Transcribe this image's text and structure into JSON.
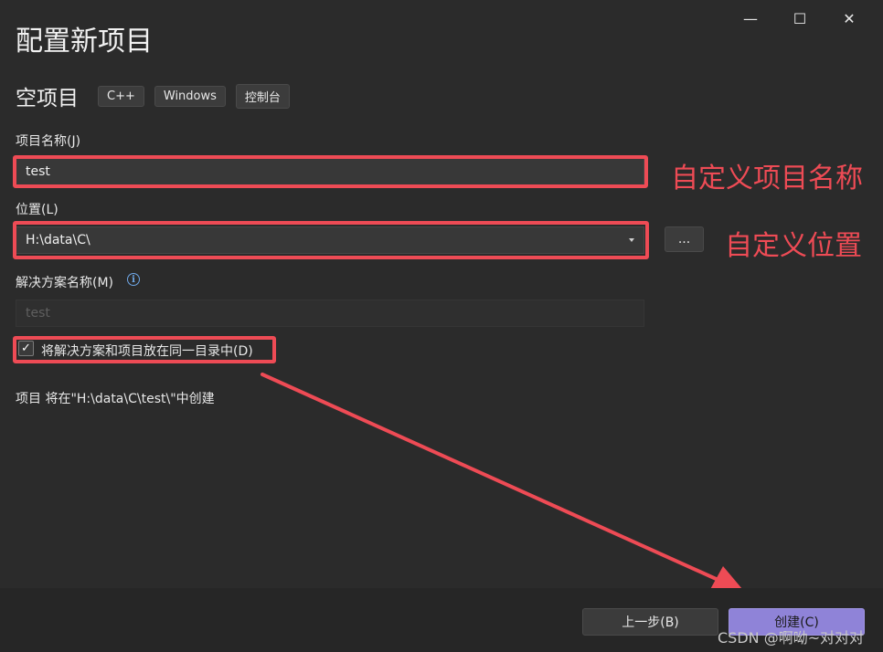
{
  "window": {
    "title": "配置新项目",
    "controls": {
      "minimize": "—",
      "maximize": "☐",
      "close": "✕"
    }
  },
  "template": {
    "name": "空项目",
    "tags": [
      "C++",
      "Windows",
      "控制台"
    ]
  },
  "fields": {
    "project_name": {
      "label": "项目名称(J)",
      "value": "test"
    },
    "location": {
      "label": "位置(L)",
      "value": "H:\\data\\C\\",
      "browse_label": "..."
    },
    "solution_name": {
      "label": "解决方案名称(M)",
      "value": "test",
      "info_icon": "i"
    }
  },
  "same_dir_checkbox": {
    "checked": true,
    "check_glyph": "✓",
    "label": "将解决方案和项目放在同一目录中(D)"
  },
  "summary": "项目 将在\"H:\\data\\C\\test\\\"中创建",
  "footer": {
    "back_label": "上一步(B)",
    "create_label": "创建(C)"
  },
  "annotations": {
    "name_note": "自定义项目名称",
    "location_note": "自定义位置"
  },
  "watermark": "CSDN @啊呦~对对对",
  "colors": {
    "background": "#2b2b2b",
    "highlight": "#ee4b55",
    "primary_button": "#8f83d8"
  }
}
